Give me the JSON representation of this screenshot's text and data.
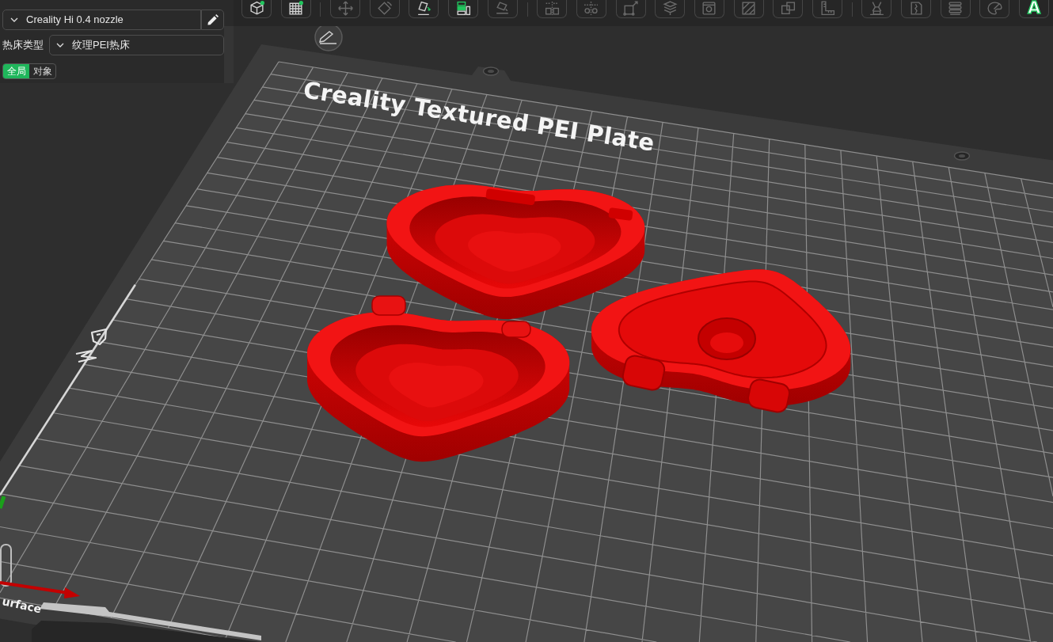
{
  "settings_panel": {
    "nozzle_preset": "Creality Hi 0.4 nozzle",
    "bed_type": {
      "label": "热床类型",
      "value": "纹理PEI热床"
    },
    "scope_tabs": [
      {
        "label": "全局",
        "selected": true
      },
      {
        "label": "对象",
        "selected": false
      }
    ]
  },
  "toolbar": {
    "tool_groups": [
      [
        {
          "kind": "add",
          "disabled": false
        },
        {
          "kind": "plate",
          "disabled": false
        }
      ],
      [
        {
          "kind": "move",
          "disabled": true
        },
        {
          "kind": "rotate",
          "disabled": true
        },
        {
          "kind": "place",
          "disabled": false
        },
        {
          "kind": "arrange",
          "disabled": false
        },
        {
          "kind": "lay_on_face",
          "disabled": true
        }
      ],
      [
        {
          "kind": "split_objects",
          "disabled": true
        },
        {
          "kind": "split_parts",
          "disabled": true
        },
        {
          "kind": "scale",
          "disabled": true
        },
        {
          "kind": "cut",
          "disabled": true
        },
        {
          "kind": "hollow",
          "disabled": true
        },
        {
          "kind": "fuzzy",
          "disabled": true
        },
        {
          "kind": "boolean",
          "disabled": true
        },
        {
          "kind": "measure",
          "disabled": true
        }
      ],
      [
        {
          "kind": "support",
          "disabled": true
        },
        {
          "kind": "seam",
          "disabled": true
        },
        {
          "kind": "layers",
          "disabled": true
        },
        {
          "kind": "paint",
          "disabled": true
        },
        {
          "kind": "text",
          "label": "A",
          "disabled": false
        }
      ]
    ]
  },
  "viewport": {
    "plate_name": "Creality Textured PEI Plate",
    "axis_label": "urface"
  }
}
